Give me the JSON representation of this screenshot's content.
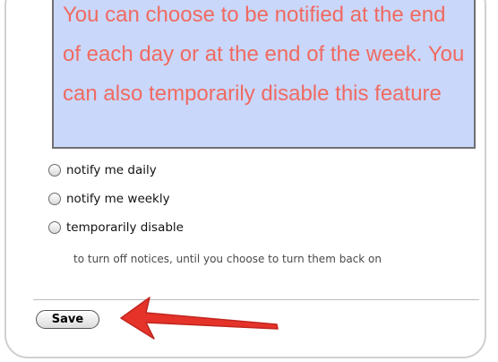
{
  "callout": {
    "text": "You can choose to be notified at the end of each day or at the end of the week.  You can also temporarily disable this feature",
    "colors": {
      "background": "#c9d7fb",
      "text": "#f06a60",
      "border": "#707070"
    }
  },
  "options": [
    {
      "label": "notify me daily",
      "selected": false
    },
    {
      "label": "notify me weekly",
      "selected": false
    },
    {
      "label": "temporarily disable",
      "selected": false
    }
  ],
  "hint": "to turn off notices, until you choose to turn them back on",
  "save_button": {
    "label": "Save"
  },
  "annotation": {
    "arrow_color": "#e5332a",
    "icon": "red-arrow-icon"
  }
}
